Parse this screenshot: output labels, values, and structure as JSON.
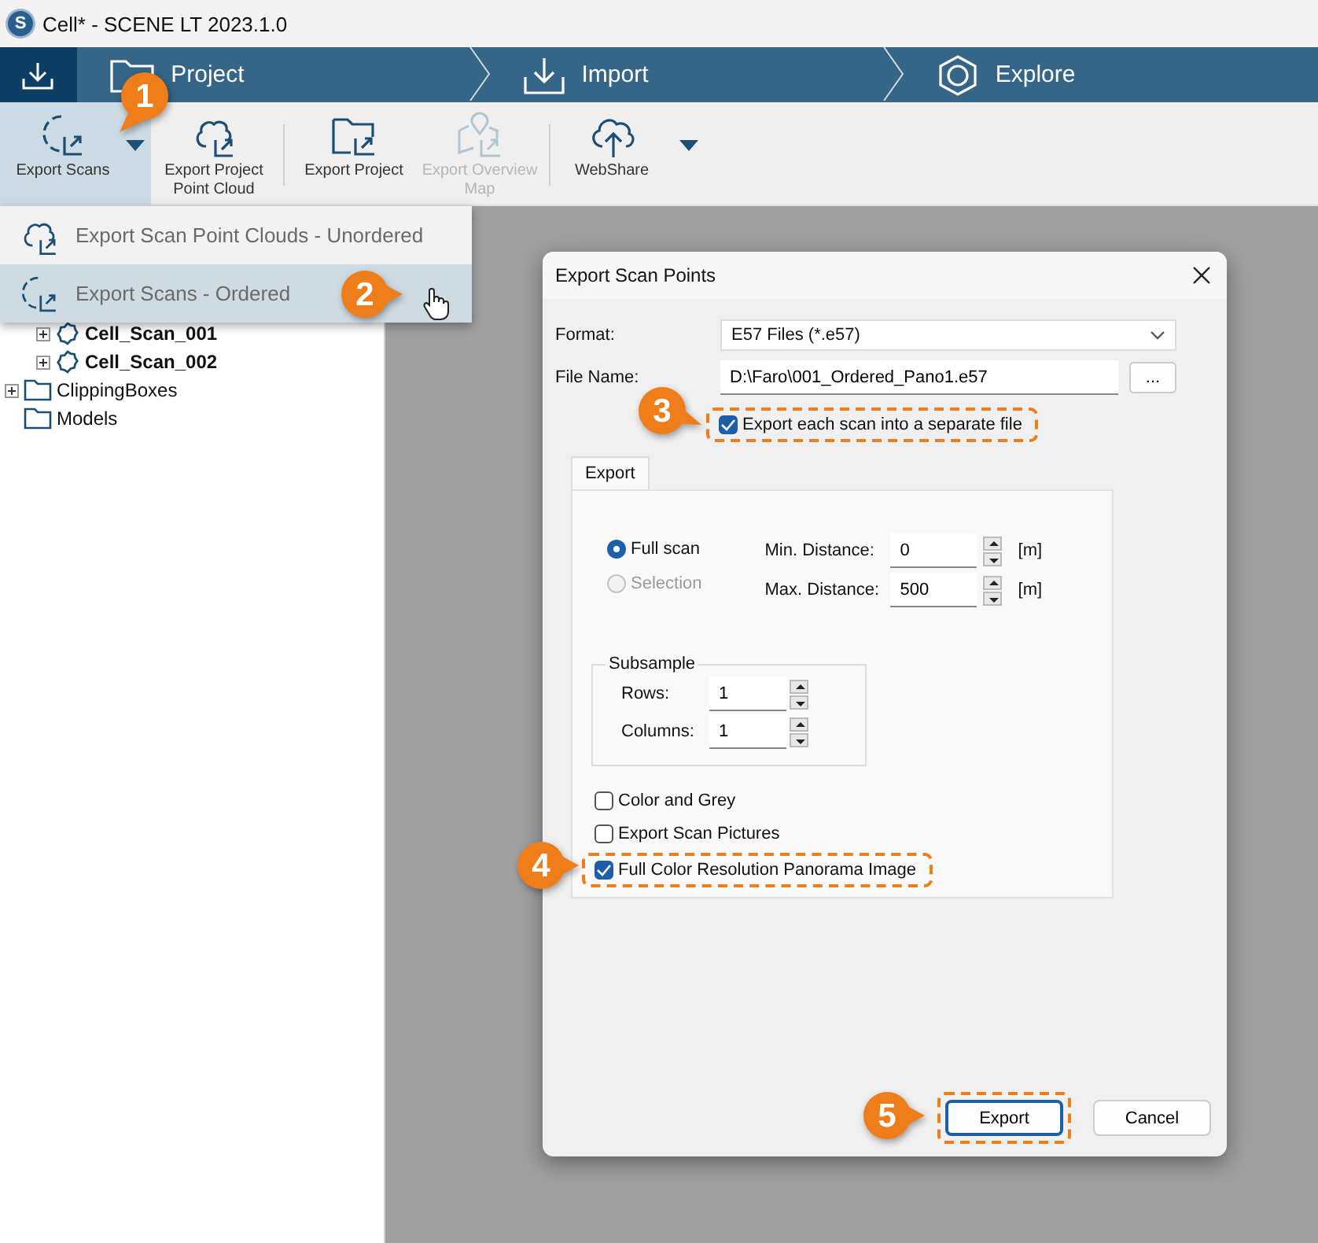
{
  "window": {
    "logo": "S",
    "title": "Cell* - SCENE LT 2023.1.0"
  },
  "workflow": [
    {
      "label": "Project"
    },
    {
      "label": "Import"
    },
    {
      "label": "Explore"
    }
  ],
  "toolbar": [
    {
      "label": "Export Scans",
      "selected": true,
      "disabled": false,
      "dropdown": true,
      "callout": "1"
    },
    {
      "label": "Export Project Point Cloud",
      "selected": false,
      "disabled": false,
      "dropdown": false
    },
    {
      "label": "Export Project",
      "selected": false,
      "disabled": false,
      "dropdown": false
    },
    {
      "label": "Export Overview Map",
      "selected": false,
      "disabled": true,
      "dropdown": false
    },
    {
      "label": "WebShare",
      "selected": false,
      "disabled": false,
      "dropdown": true
    }
  ],
  "menu": [
    {
      "label": "Export Scan Point Clouds - Unordered",
      "selected": false
    },
    {
      "label": "Export Scans - Ordered",
      "selected": true,
      "callout": "2"
    }
  ],
  "tree": [
    {
      "kind": "group",
      "children": [
        {
          "label": "Cell_Scan_001",
          "kind": "scan",
          "expandable": true
        },
        {
          "label": "Cell_Scan_002",
          "kind": "scan",
          "expandable": true
        }
      ]
    },
    {
      "label": "ClippingBoxes",
      "kind": "folder",
      "expandable": true
    },
    {
      "label": "Models",
      "kind": "folder",
      "expandable": false
    }
  ],
  "dialog": {
    "title": "Export Scan Points",
    "format": {
      "label": "Format:",
      "value": "E57 Files (*.e57)"
    },
    "file_name": {
      "label": "File Name:",
      "value": "D:\\Faro\\001_Ordered_Pano1.e57",
      "browse": "..."
    },
    "separate_file": {
      "label": "Export each scan into a separate file",
      "checked": true,
      "callout": "3"
    },
    "tab": {
      "label": "Export"
    },
    "scope": [
      {
        "label": "Full scan",
        "selected": true,
        "disabled": false
      },
      {
        "label": "Selection",
        "selected": false,
        "disabled": true
      }
    ],
    "distances": [
      {
        "label": "Min. Distance:",
        "value": "0",
        "unit": "[m]"
      },
      {
        "label": "Max. Distance:",
        "value": "500",
        "unit": "[m]"
      }
    ],
    "subsample": {
      "title": "Subsample",
      "fields": [
        {
          "label": "Rows:",
          "value": "1"
        },
        {
          "label": "Columns:",
          "value": "1"
        }
      ]
    },
    "options": [
      {
        "label": "Color and Grey",
        "checked": false
      },
      {
        "label": "Export Scan Pictures",
        "checked": false
      },
      {
        "label": "Full Color Resolution Panorama Image",
        "checked": true,
        "callout": "4"
      }
    ],
    "buttons": [
      {
        "label": "Export",
        "default": true,
        "callout": "5"
      },
      {
        "label": "Cancel",
        "default": false
      }
    ]
  }
}
